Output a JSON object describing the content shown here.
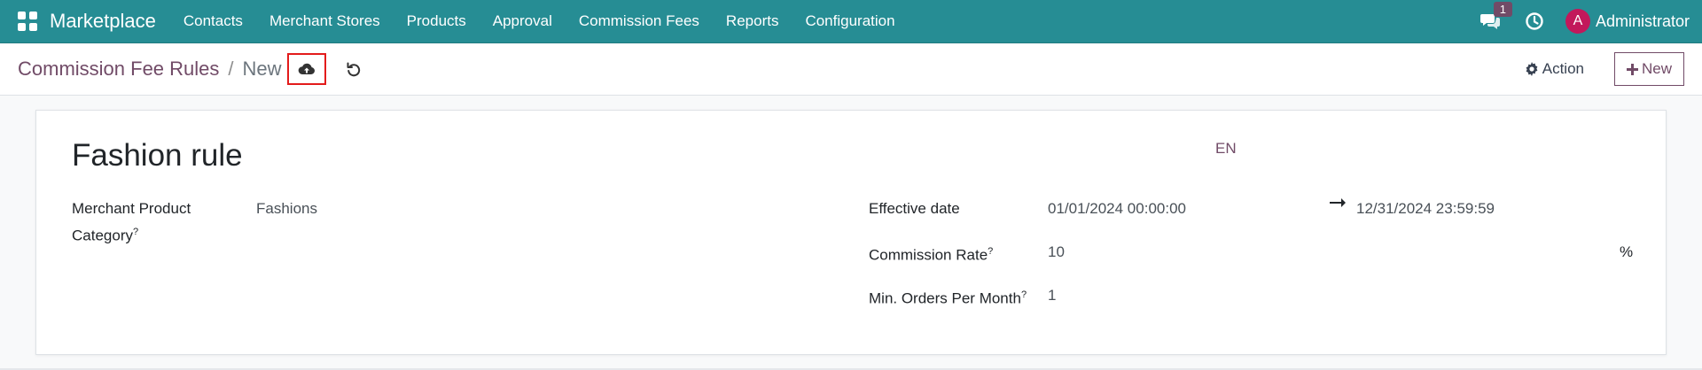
{
  "navbar": {
    "brand": "Marketplace",
    "menu": [
      "Contacts",
      "Merchant Stores",
      "Products",
      "Approval",
      "Commission Fees",
      "Reports",
      "Configuration"
    ],
    "chat_count": "1",
    "avatar_letter": "A",
    "user": "Administrator",
    "color": "#268d94"
  },
  "control": {
    "breadcrumb_parent": "Commission Fee Rules",
    "breadcrumb_separator": "/",
    "breadcrumb_current": "New",
    "action_label": "Action",
    "new_label": "New"
  },
  "form": {
    "title": "Fashion rule",
    "language": "EN",
    "merchant_category_label_1": "Merchant Product",
    "merchant_category_label_2": "Category",
    "merchant_category_value": "Fashions",
    "effective_date_label": "Effective date",
    "effective_date_start": "01/01/2024 00:00:00",
    "effective_date_end": "12/31/2024 23:59:59",
    "commission_rate_label": "Commission Rate",
    "commission_rate_value": "10",
    "commission_rate_unit": "%",
    "min_orders_label": "Min. Orders Per Month",
    "min_orders_value": "1",
    "hint_mark": "?"
  }
}
